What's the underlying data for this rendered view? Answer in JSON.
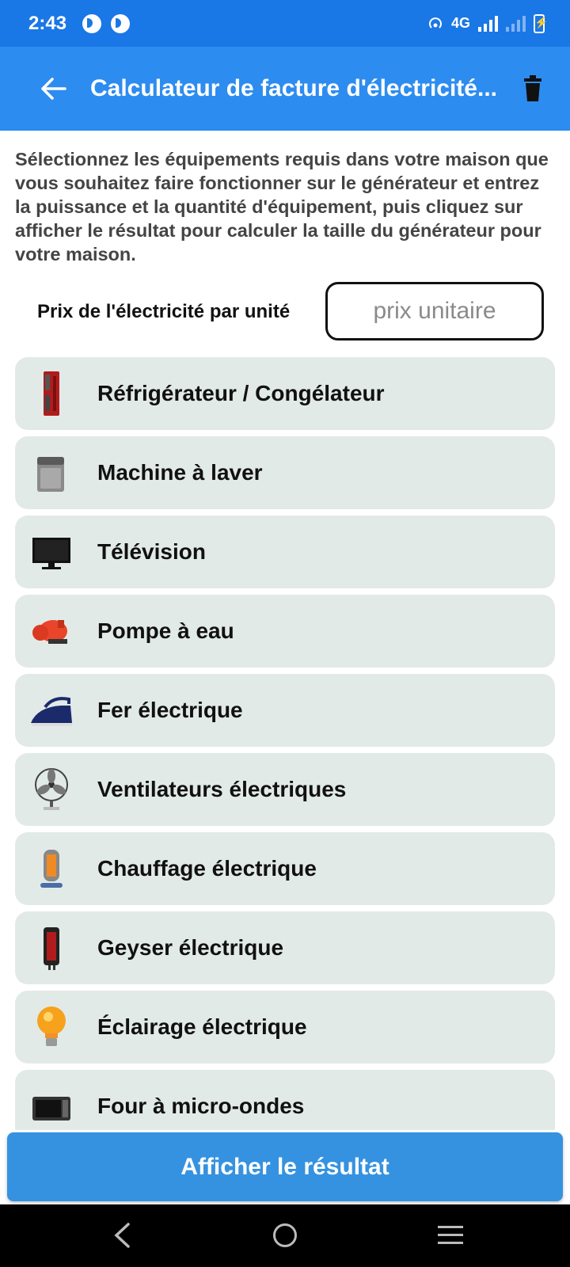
{
  "status_bar": {
    "time": "2:43",
    "network": "4G"
  },
  "app_bar": {
    "title": "Calculateur de facture d'électricité..."
  },
  "intro_text": "Sélectionnez les équipements requis dans votre maison que vous souhaitez faire fonctionner sur le générateur et entrez la puissance et la quantité d'équipement, puis cliquez sur afficher le résultat pour calculer la taille du générateur pour votre maison.",
  "price": {
    "label": "Prix de l'électricité par unité",
    "placeholder": "prix unitaire",
    "value": ""
  },
  "appliances": [
    {
      "label": "Réfrigérateur / Congélateur",
      "icon": "refrigerator-icon"
    },
    {
      "label": "Machine à laver",
      "icon": "washing-machine-icon"
    },
    {
      "label": "Télévision",
      "icon": "television-icon"
    },
    {
      "label": "Pompe à eau",
      "icon": "water-pump-icon"
    },
    {
      "label": "Fer électrique",
      "icon": "iron-icon"
    },
    {
      "label": "Ventilateurs électriques",
      "icon": "fan-icon"
    },
    {
      "label": "Chauffage électrique",
      "icon": "heater-icon"
    },
    {
      "label": "Geyser électrique",
      "icon": "geyser-icon"
    },
    {
      "label": "Éclairage électrique",
      "icon": "light-bulb-icon"
    },
    {
      "label": "Four à micro-ondes",
      "icon": "microwave-icon"
    }
  ],
  "result_button": "Afficher le résultat",
  "colors": {
    "status_bar": "#1a77e6",
    "app_bar": "#2d8cf0",
    "item_background": "#e2eae8",
    "button": "#3592e0"
  }
}
